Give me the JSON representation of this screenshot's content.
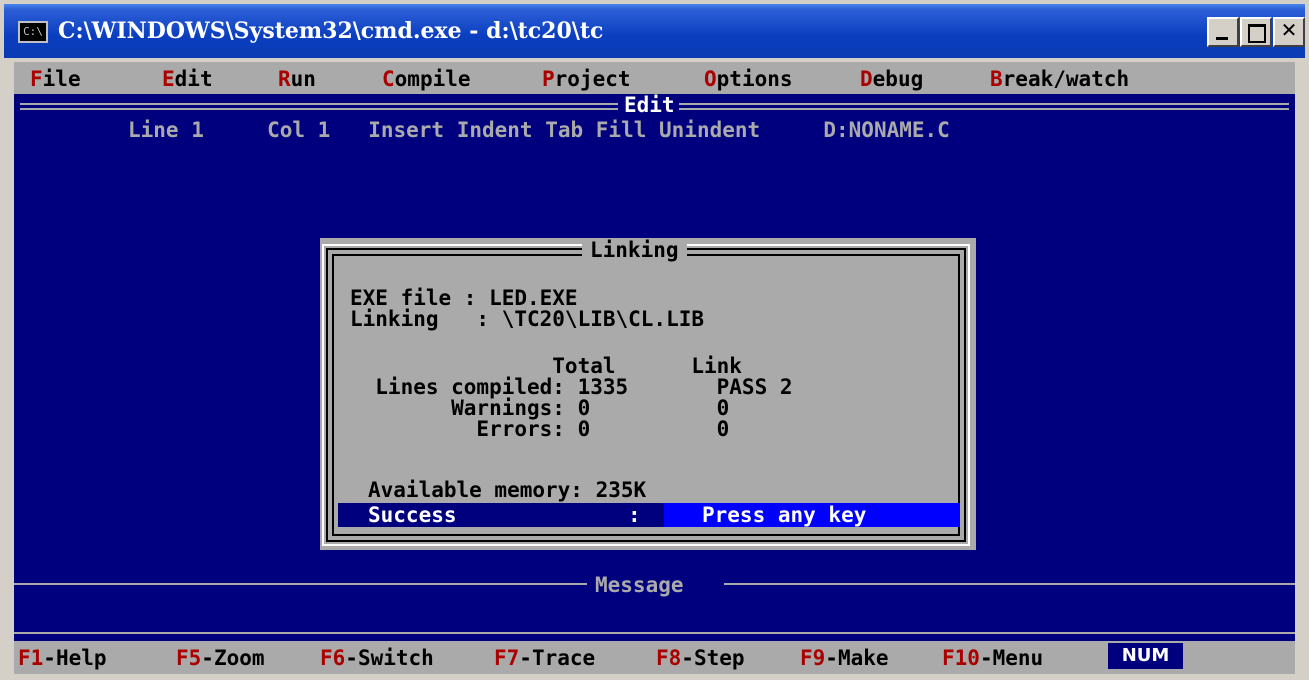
{
  "window": {
    "title": "C:\\WINDOWS\\System32\\cmd.exe - d:\\tc20\\tc",
    "icon_label": "C:\\",
    "minimize_icon": "minimize-icon",
    "maximize_icon": "maximize-icon",
    "close_glyph": "✕"
  },
  "menubar": {
    "items": [
      {
        "hot": "F",
        "rest": "ile"
      },
      {
        "hot": "E",
        "rest": "dit"
      },
      {
        "hot": "R",
        "rest": "un"
      },
      {
        "hot": "C",
        "rest": "ompile"
      },
      {
        "hot": "P",
        "rest": "roject"
      },
      {
        "hot": "O",
        "rest": "ptions"
      },
      {
        "hot": "D",
        "rest": "ebug"
      },
      {
        "hot": "B",
        "rest": "reak/watch"
      }
    ]
  },
  "editor": {
    "title": "Edit",
    "status": "Line 1     Col 1   Insert Indent Tab Fill Unindent     D:NONAME.C"
  },
  "dialog": {
    "title": "Linking",
    "exe_line": "EXE file : LED.EXE",
    "linking_line": "Linking   : \\TC20\\LIB\\CL.LIB",
    "header_row": "                Total      Link",
    "lines_row": "  Lines compiled: 1335       PASS 2",
    "warnings_row": "        Warnings: 0          0",
    "errors_row": "          Errors: 0          0",
    "memory_line": "Available memory: 235K",
    "result_label": "Success",
    "result_colon": ":",
    "result_key": "Press any key"
  },
  "message": {
    "title": "Message"
  },
  "fkeys": {
    "items": [
      {
        "hot": "F1",
        "rest": "-Help"
      },
      {
        "hot": "F5",
        "rest": "-Zoom"
      },
      {
        "hot": "F6",
        "rest": "-Switch"
      },
      {
        "hot": "F7",
        "rest": "-Trace"
      },
      {
        "hot": "F8",
        "rest": "-Step"
      },
      {
        "hot": "F9",
        "rest": "-Make"
      },
      {
        "hot": "F10",
        "rest": "-Menu"
      }
    ],
    "num": "NUM"
  },
  "colors": {
    "background": "#00007f",
    "menu_bg": "#aaaaaa",
    "hotkey": "#aa0000",
    "highlight": "#0000ff"
  }
}
